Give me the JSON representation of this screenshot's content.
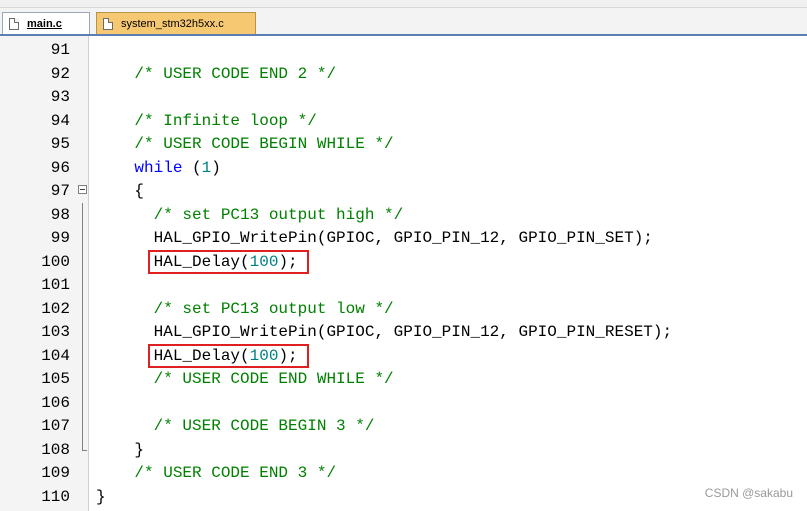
{
  "tabs": [
    {
      "label": "main.c",
      "active": true
    },
    {
      "label": "system_stm32h5xx.c",
      "active": false
    }
  ],
  "lines": [
    {
      "num": "91",
      "parts": []
    },
    {
      "num": "92",
      "parts": [
        [
          "    ",
          ""
        ],
        [
          "/* USER CODE END 2 */",
          "cm"
        ]
      ]
    },
    {
      "num": "93",
      "parts": []
    },
    {
      "num": "94",
      "parts": [
        [
          "    ",
          ""
        ],
        [
          "/* Infinite loop */",
          "cm"
        ]
      ]
    },
    {
      "num": "95",
      "parts": [
        [
          "    ",
          ""
        ],
        [
          "/* USER CODE BEGIN WHILE */",
          "cm"
        ]
      ]
    },
    {
      "num": "96",
      "parts": [
        [
          "    ",
          ""
        ],
        [
          "while",
          "kw"
        ],
        [
          " (",
          ""
        ],
        [
          "1",
          "num"
        ],
        [
          ")",
          ""
        ]
      ]
    },
    {
      "num": "97",
      "parts": [
        [
          "    {",
          ""
        ]
      ],
      "fold": "open"
    },
    {
      "num": "98",
      "parts": [
        [
          "      ",
          ""
        ],
        [
          "/* set PC13 output high */",
          "cm"
        ]
      ],
      "fold": "line"
    },
    {
      "num": "99",
      "parts": [
        [
          "      HAL_GPIO_WritePin(GPIOC, GPIO_PIN_12, GPIO_PIN_SET);",
          ""
        ]
      ],
      "fold": "line"
    },
    {
      "num": "100",
      "parts": [
        [
          "      HAL_Delay(",
          ""
        ],
        [
          "100",
          "num"
        ],
        [
          ");",
          ""
        ]
      ],
      "fold": "line",
      "highlight": true
    },
    {
      "num": "101",
      "parts": [],
      "fold": "line"
    },
    {
      "num": "102",
      "parts": [
        [
          "      ",
          ""
        ],
        [
          "/* set PC13 output low */",
          "cm"
        ]
      ],
      "fold": "line"
    },
    {
      "num": "103",
      "parts": [
        [
          "      HAL_GPIO_WritePin(GPIOC, GPIO_PIN_12, GPIO_PIN_RESET);",
          ""
        ]
      ],
      "fold": "line"
    },
    {
      "num": "104",
      "parts": [
        [
          "      HAL_Delay(",
          ""
        ],
        [
          "100",
          "num"
        ],
        [
          ");",
          ""
        ]
      ],
      "fold": "line",
      "highlight": true
    },
    {
      "num": "105",
      "parts": [
        [
          "      ",
          ""
        ],
        [
          "/* USER CODE END WHILE */",
          "cm"
        ]
      ],
      "fold": "line"
    },
    {
      "num": "106",
      "parts": [],
      "fold": "line"
    },
    {
      "num": "107",
      "parts": [
        [
          "      ",
          ""
        ],
        [
          "/* USER CODE BEGIN 3 */",
          "cm"
        ]
      ],
      "fold": "line"
    },
    {
      "num": "108",
      "parts": [
        [
          "    }",
          ""
        ]
      ],
      "fold": "end"
    },
    {
      "num": "109",
      "parts": [
        [
          "    ",
          ""
        ],
        [
          "/* USER CODE END 3 */",
          "cm"
        ]
      ]
    },
    {
      "num": "110",
      "parts": [
        [
          "}",
          ""
        ]
      ]
    }
  ],
  "watermark": "CSDN @sakabu",
  "colors": {
    "comment": "#008000",
    "keyword": "#0000ff",
    "number": "#008080",
    "highlight_box": "#e02020",
    "active_tab_bg": "#ffffff",
    "inactive_tab_bg": "#f7c872"
  },
  "icons": [
    "file-icon",
    "fold-collapse-icon"
  ]
}
